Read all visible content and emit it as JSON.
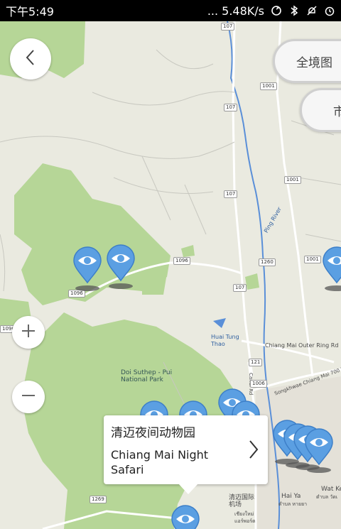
{
  "status_bar": {
    "time": "下午5:49",
    "network_speed": "... 5.48K/s",
    "icons": [
      "sync-icon",
      "bluetooth-icon",
      "mute-icon",
      "alarm-icon"
    ]
  },
  "toolbar": {
    "back_icon": "chevron-left-icon",
    "panorama_label": "全境图",
    "city_label": "市"
  },
  "zoom": {
    "zoom_in_symbol": "+",
    "zoom_out_symbol": "−"
  },
  "map": {
    "labels": {
      "doi_suthep": "Doi Suthep - Pui\nNational Park",
      "chiang_mai_outer_ring": "Chiang Mai Outer Ring Rd",
      "huai_tung_thao": "Huai Tung\nThao",
      "ping_river": "Ping River",
      "canal_rd": "Canal Rd",
      "airport_cn": "清迈国际\n机场",
      "airport_th": "เชียงใหม่\nแอร์พอร์ต",
      "hai_ya": "Hai Ya",
      "hai_ya_th": "ตำบล หายยา",
      "wat_ket": "Wat Ke",
      "wat_ket_th": "ตำบล วัดเ",
      "songkhwae_rd": "Songkhwae Chiang Mai 700 Yr Rd",
      "r107a": "107",
      "r107b": "107",
      "r107c": "107",
      "r107d": "107",
      "r1001a": "1001",
      "r1001b": "1001",
      "r1001c": "1001",
      "r1096a": "1096",
      "r1096b": "1096",
      "r1096c": "1096",
      "r1260": "1260",
      "r1269": "1269",
      "r121": "121",
      "r1006": "1006"
    },
    "pin_icon": "eye-icon"
  },
  "callout": {
    "title": "清迈夜间动物园",
    "subtitle": "Chiang Mai Night Safari",
    "chevron_icon": "chevron-right-icon"
  },
  "colors": {
    "map_background": "#eaeae0",
    "park_green": "#b6d697",
    "water_blue": "#5a8fd8",
    "pin_blue": "#5b9fe2",
    "road": "#ffffff"
  }
}
